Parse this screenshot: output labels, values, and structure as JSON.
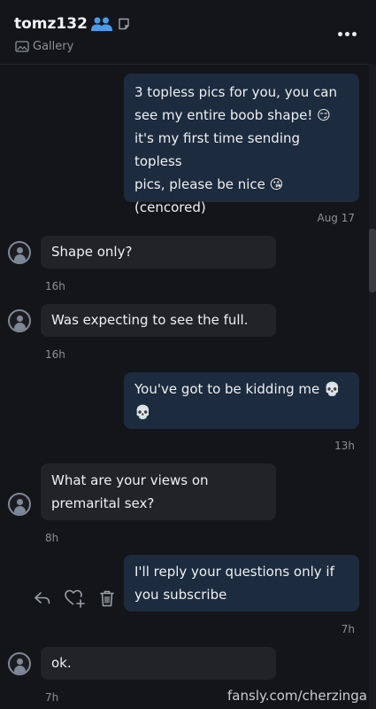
{
  "header": {
    "username": "tomz132",
    "subtitle": "Gallery"
  },
  "messages": [
    {
      "dir": "out",
      "lines": [
        "3 topless pics for you, you can",
        "see my entire boob shape! 😏",
        "it's my first time sending topless",
        "pics, please be nice 😘",
        "(cencored)"
      ],
      "time": "Aug 17"
    },
    {
      "dir": "in",
      "lines": [
        "Shape only?"
      ],
      "time": "16h"
    },
    {
      "dir": "in",
      "lines": [
        "Was expecting to see the full."
      ],
      "time": "16h"
    },
    {
      "dir": "out",
      "lines": [
        "You've got to be kidding me 💀",
        "💀"
      ],
      "time": "13h"
    },
    {
      "dir": "in",
      "lines": [
        "What are your views on",
        "premarital sex?"
      ],
      "time": "8h"
    },
    {
      "dir": "out",
      "lines": [
        "I'll reply your questions only if",
        "you subscribe"
      ],
      "time": "7h"
    },
    {
      "dir": "in",
      "lines": [
        "ok."
      ],
      "time": "7h"
    }
  ],
  "watermark": "fansly.com/cherzinga",
  "colors": {
    "background": "#141518",
    "outgoing_bubble": "#1c2b3d",
    "incoming_bubble": "#222327",
    "accent_blue": "#4a9be8"
  },
  "icons": [
    "users-icon",
    "note-icon",
    "gallery-icon",
    "more-icon",
    "avatar-icon",
    "reply-icon",
    "add-reaction-icon",
    "trash-icon"
  ]
}
